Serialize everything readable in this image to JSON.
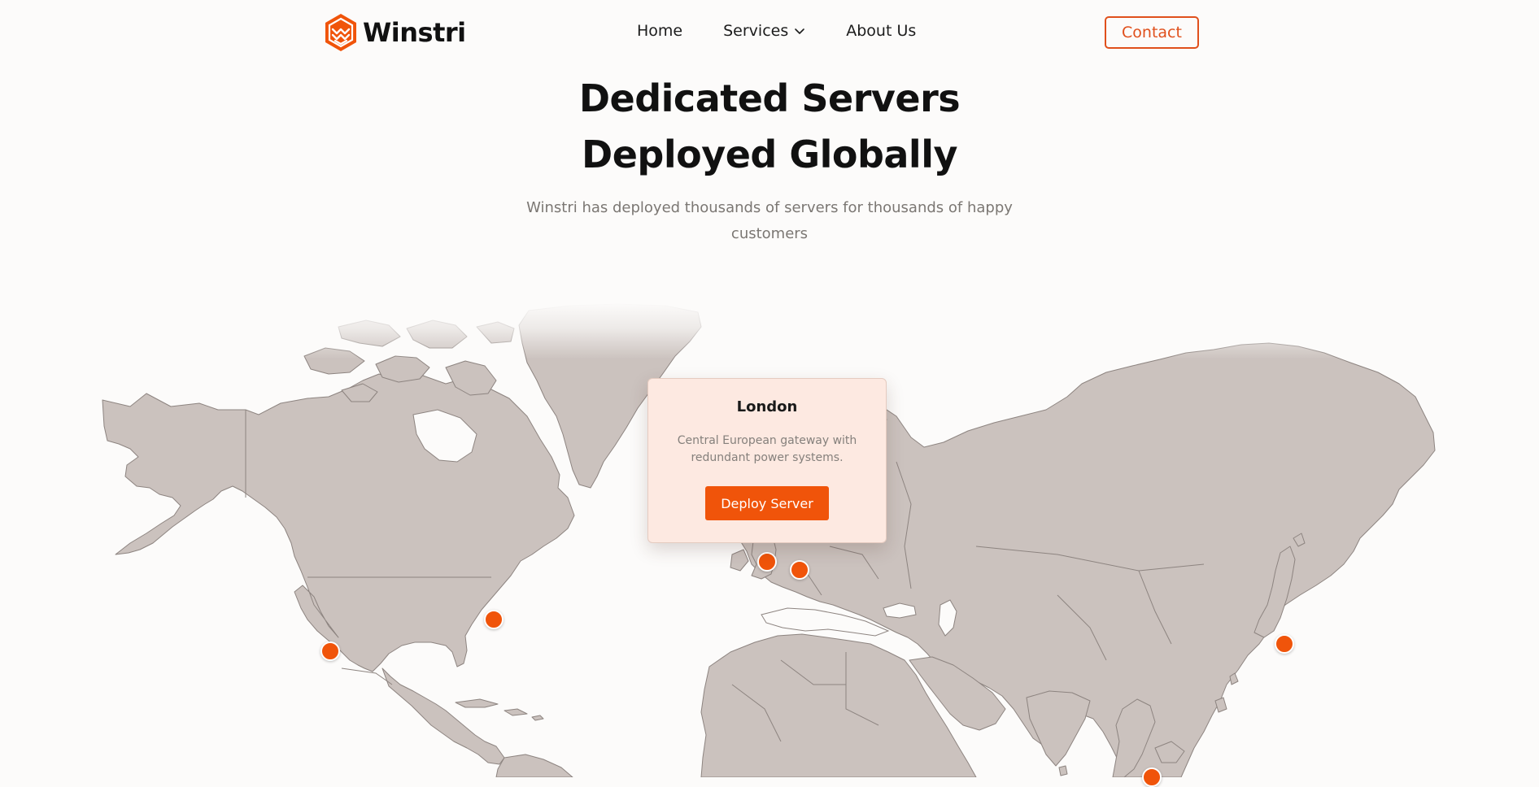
{
  "brand": {
    "name": "Winstri",
    "logo_icon": "hexagon-chevron-logo",
    "accent_color": "#f0540a"
  },
  "nav": {
    "items": [
      {
        "label": "Home"
      },
      {
        "label": "Services",
        "icon": "chevron-down-icon"
      },
      {
        "label": "About Us"
      }
    ],
    "contact_label": "Contact"
  },
  "hero": {
    "title_line1": "Dedicated Servers",
    "title_line2": "Deployed Globally",
    "subtitle": "Winstri has deployed thousands of servers for thousands of happy customers"
  },
  "map": {
    "land_color": "#cbc2be",
    "pin_color": "#f0540a",
    "locations": [
      "London"
    ]
  },
  "popup": {
    "title": "London",
    "description": "Central European gateway with redundant power systems.",
    "button_label": "Deploy Server"
  }
}
